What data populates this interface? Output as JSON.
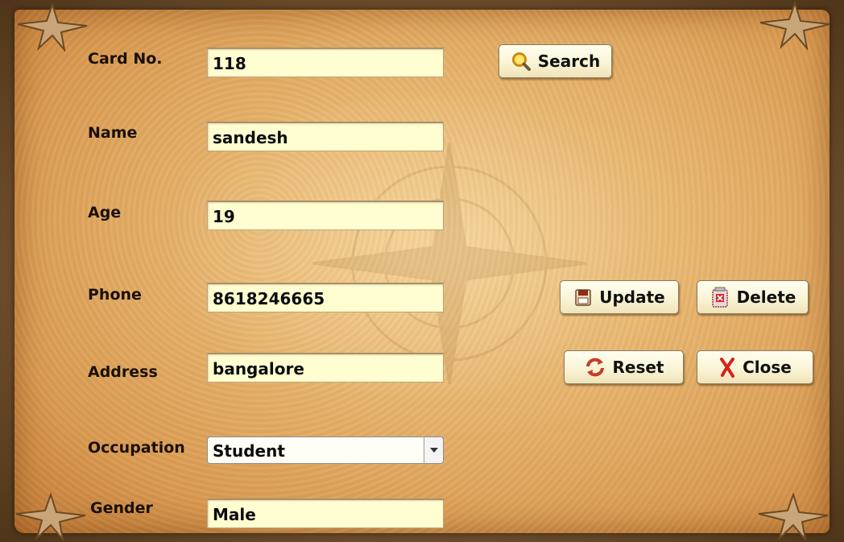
{
  "form": {
    "card_no": {
      "label": "Card No.",
      "value": "118"
    },
    "name": {
      "label": "Name",
      "value": "sandesh"
    },
    "age": {
      "label": "Age",
      "value": "19"
    },
    "phone": {
      "label": "Phone",
      "value": "8618246665"
    },
    "address": {
      "label": "Address",
      "value": "bangalore"
    },
    "occupation": {
      "label": "Occupation",
      "value": "Student"
    },
    "gender": {
      "label": "Gender",
      "value": "Male"
    }
  },
  "buttons": {
    "search": {
      "label": "Search",
      "icon": "magnifier-icon"
    },
    "update": {
      "label": "Update",
      "icon": "save-icon"
    },
    "delete": {
      "label": "Delete",
      "icon": "delete-icon"
    },
    "reset": {
      "label": "Reset",
      "icon": "refresh-icon"
    },
    "close": {
      "label": "Close",
      "icon": "close-x-icon"
    }
  },
  "colors": {
    "field_bg": "#fffed0",
    "parchment": "#e8b873",
    "frame": "#6a4a2a"
  }
}
